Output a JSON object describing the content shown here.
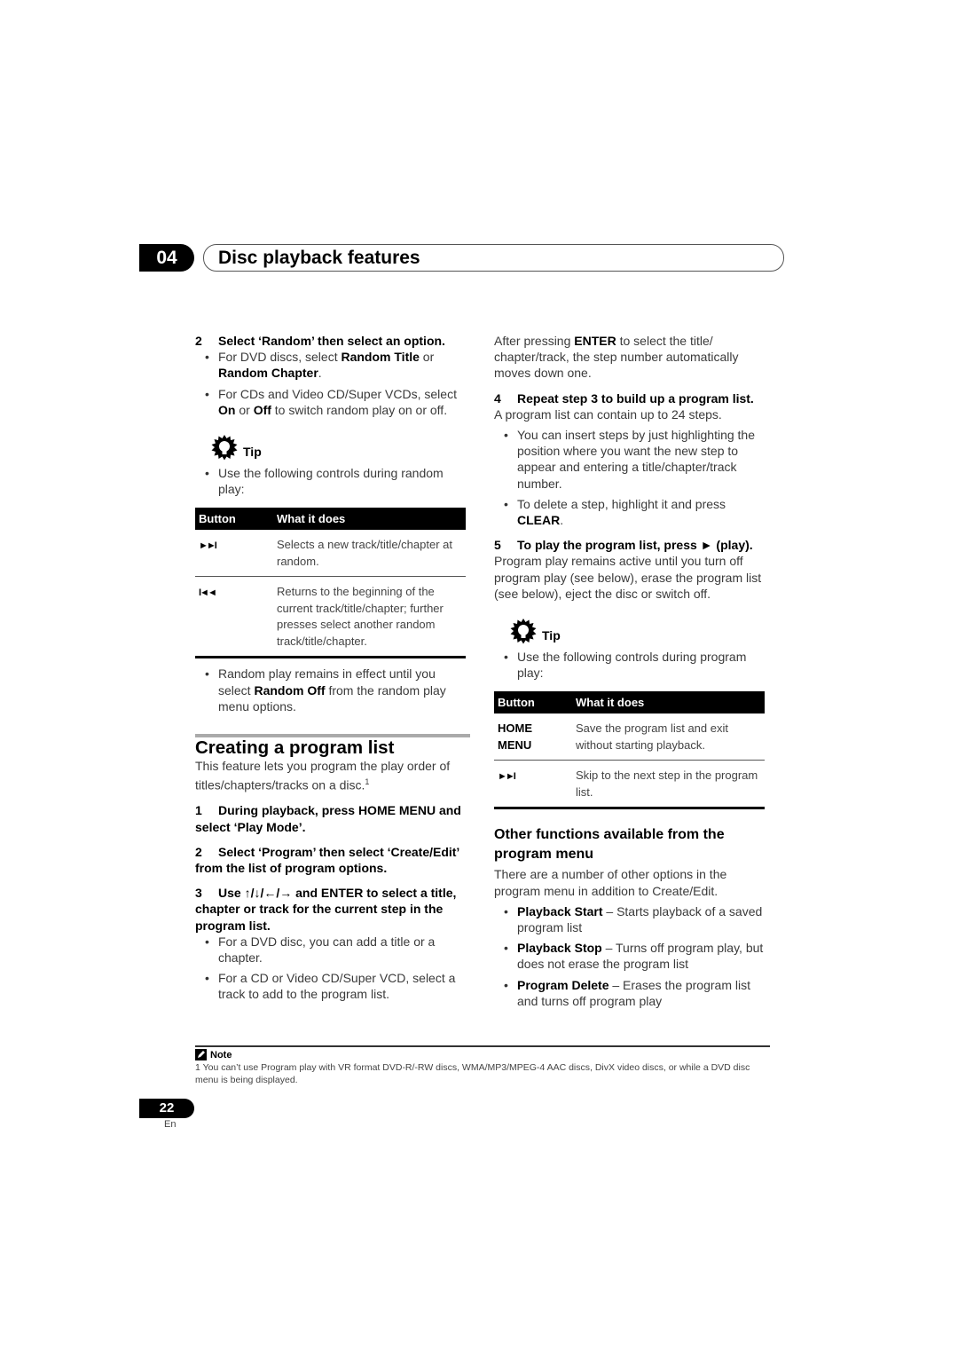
{
  "header": {
    "chapter_number": "04",
    "chapter_title": "Disc playback features"
  },
  "left_column": {
    "step2": {
      "num": "2",
      "text": "Select ‘Random’ then select an option."
    },
    "step2_bullets": [
      {
        "pre": "For DVD discs, select ",
        "b1": "Random Title",
        "mid": " or ",
        "b2": "Random Chapter",
        "post": "."
      },
      {
        "pre": "For CDs and Video CD/Super VCDs, select ",
        "b1": "On",
        "mid": " or ",
        "b2": "Off",
        "post": " to switch random play on or off."
      }
    ],
    "tip": {
      "label": "Tip",
      "bullet": "Use the following controls during random play:",
      "table": {
        "headers": [
          "Button",
          "What it does"
        ],
        "rows": [
          {
            "button": "►►I",
            "button_icon": "next-track-icon",
            "desc": "Selects a new track/title/chapter at random."
          },
          {
            "button": "I◄◄",
            "button_icon": "previous-track-icon",
            "desc": "Returns to the beginning of the current track/title/chapter; further presses select another random track/title/chapter."
          }
        ]
      },
      "after": {
        "pre": "Random play remains in effect until you select ",
        "b": "Random Off",
        "post": " from the random play menu options."
      }
    },
    "section": {
      "title": "Creating a program list",
      "intro": "This feature lets you program the play order of titles/chapters/tracks on a disc.",
      "intro_footnote": "1",
      "steps": [
        {
          "num": "1",
          "text": "During playback, press HOME MENU and select ‘Play Mode’."
        },
        {
          "num": "2",
          "text": "Select ‘Program’ then select ‘Create/Edit’ from the list of program options."
        },
        {
          "num": "3",
          "pre": "Use ",
          "arrows": "↑/↓/←/→",
          "post": " and ENTER to select a title, chapter or track for the current step in the program list."
        }
      ],
      "step3_bullets": [
        "For a DVD disc, you can add a title or a chapter.",
        "For a CD or Video CD/Super VCD, select a track to add to the program list."
      ]
    }
  },
  "right_column": {
    "after_enter": {
      "pre": "After pressing ",
      "b": "ENTER",
      "post": " to select the title/ chapter/track, the step number automatically moves down one."
    },
    "step4": {
      "num": "4",
      "text": "Repeat step 3 to build up a program list.",
      "desc": "A program list can contain up to 24 steps."
    },
    "step4_bullets": [
      {
        "pre": "You can insert steps by just highlighting the position where you want the new step to appear and entering a title/chapter/track number.",
        "b": "",
        "post": ""
      },
      {
        "pre": "To delete a step, highlight it and press ",
        "b": "CLEAR",
        "post": "."
      }
    ],
    "step5": {
      "num": "5",
      "text": "To play the program list, press ► (play).",
      "desc": "Program play remains active until you turn off program play (see below), erase the program list (see below), eject the disc or switch off."
    },
    "tip": {
      "label": "Tip",
      "bullet": "Use the following controls during program play:",
      "table": {
        "headers": [
          "Button",
          "What it does"
        ],
        "rows": [
          {
            "button": "HOME MENU",
            "desc": "Save the program list and exit without starting playback."
          },
          {
            "button": "►►I",
            "button_icon": "next-track-icon",
            "desc": "Skip to the next step in the program list."
          }
        ]
      }
    },
    "other": {
      "title": "Other functions available from the program menu",
      "intro": "There are a number of other options in the program menu in addition to Create/Edit.",
      "items": [
        {
          "b": "Playback Start",
          "text": " – Starts playback of a saved program list"
        },
        {
          "b": "Playback Stop",
          "text": " – Turns off program play, but does not erase the program list"
        },
        {
          "b": "Program Delete",
          "text": " – Erases the program list and turns off program play"
        }
      ]
    }
  },
  "note": {
    "label": "Note",
    "text": "1 You can’t use Program play with VR format DVD-R/-RW discs, WMA/MP3/MPEG-4 AAC discs, DivX video discs, or while a DVD disc menu is being displayed."
  },
  "footer": {
    "page_number": "22",
    "language": "En"
  }
}
